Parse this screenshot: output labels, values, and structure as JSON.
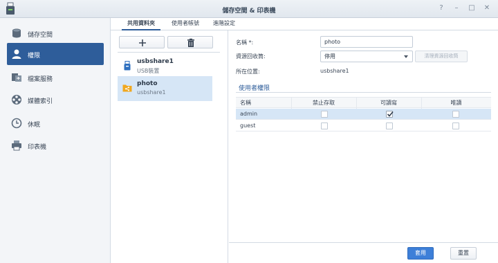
{
  "window": {
    "title": "儲存空間 & 印表機",
    "controls": [
      "?",
      "–",
      "□",
      "✕"
    ]
  },
  "sidebar": {
    "items": [
      {
        "label": "儲存空間",
        "icon": "storage-icon",
        "active": false
      },
      {
        "label": "權限",
        "icon": "user-icon",
        "active": true
      },
      {
        "label": "檔案服務",
        "icon": "file-service-icon",
        "active": false
      },
      {
        "label": "媒體索引",
        "icon": "media-reel-icon",
        "active": false
      },
      {
        "label": "休眠",
        "icon": "clock-icon",
        "active": false
      },
      {
        "label": "印表機",
        "icon": "printer-icon",
        "active": false
      }
    ]
  },
  "tabs": [
    {
      "label": "共用資料夾",
      "active": true
    },
    {
      "label": "使用者帳號",
      "active": false
    },
    {
      "label": "進階設定",
      "active": false
    }
  ],
  "folder_list": {
    "add_icon": "plus-icon",
    "delete_icon": "trash-icon",
    "items": [
      {
        "name": "usbshare1",
        "sub": "USB裝置",
        "icon": "usb-icon",
        "selected": false
      },
      {
        "name": "photo",
        "sub": "usbshare1",
        "icon": "shared-folder-icon",
        "selected": true
      }
    ]
  },
  "form": {
    "name_label": "名稱 *:",
    "name_value": "photo",
    "recycle_label": "資源回收筒:",
    "recycle_value": "停用",
    "clear_recycle_label": "清理資源回收筒",
    "location_label": "所在位置:",
    "location_value": "usbshare1"
  },
  "permissions": {
    "section_title": "使用者權限",
    "columns": [
      "名稱",
      "禁止存取",
      "可讀寫",
      "唯讀"
    ],
    "rows": [
      {
        "name": "admin",
        "deny": false,
        "rw": true,
        "ro": false,
        "selected": true
      },
      {
        "name": "guest",
        "deny": false,
        "rw": false,
        "ro": false,
        "selected": false
      }
    ]
  },
  "footer": {
    "apply_label": "套用",
    "reset_label": "重置"
  },
  "colors": {
    "accent": "#2e5d9a",
    "primary_button": "#3d7fd8",
    "selection": "#d6e6f6"
  }
}
